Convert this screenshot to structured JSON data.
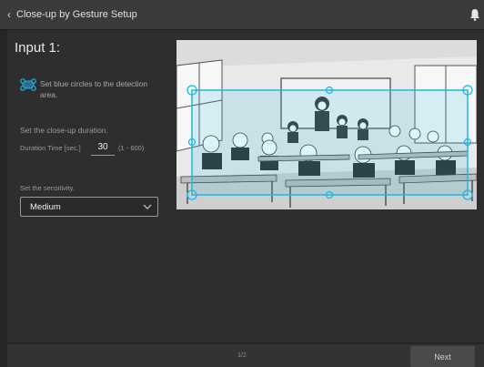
{
  "window": {
    "title": "Close-up by Gesture Setup"
  },
  "main": {
    "heading": "Input 1:",
    "instruction": "Set blue circles to the detection area.",
    "duration": {
      "section": "Set the close-up duration.",
      "label": "Duration Time [sec.]",
      "value": "30",
      "range": "(1 - 600)"
    },
    "sensitivity": {
      "section": "Set the sensitivity.",
      "selected": "Medium"
    }
  },
  "footer": {
    "page": "1/2",
    "next_label": "Next"
  },
  "colors": {
    "accent": "#1fb6e6",
    "background": "#262626"
  }
}
